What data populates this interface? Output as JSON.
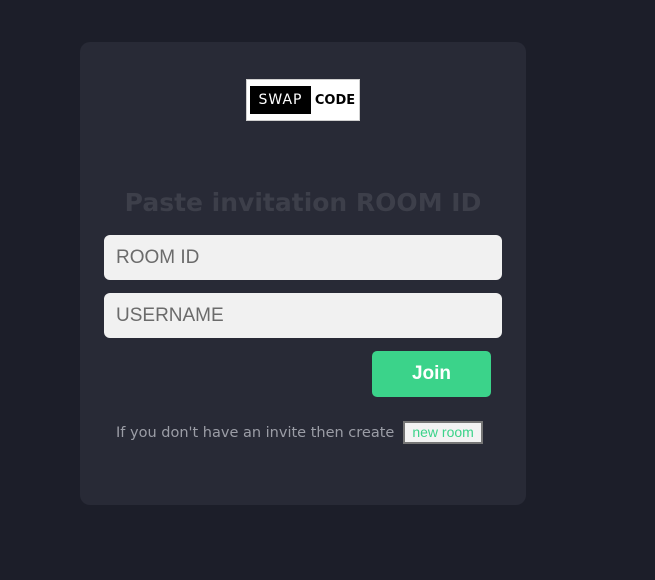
{
  "logo": {
    "left_text": "SWAP",
    "right_text": "CODE"
  },
  "form": {
    "heading": "Paste invitation ROOM ID",
    "room_id_placeholder": "ROOM ID",
    "username_placeholder": "USERNAME",
    "join_label": "Join"
  },
  "footer": {
    "invite_text": "If you don't have an invite then create",
    "new_room_label": "new room"
  },
  "colors": {
    "background": "#1c1e29",
    "card": "#282a36",
    "accent": "#3bd38a"
  }
}
